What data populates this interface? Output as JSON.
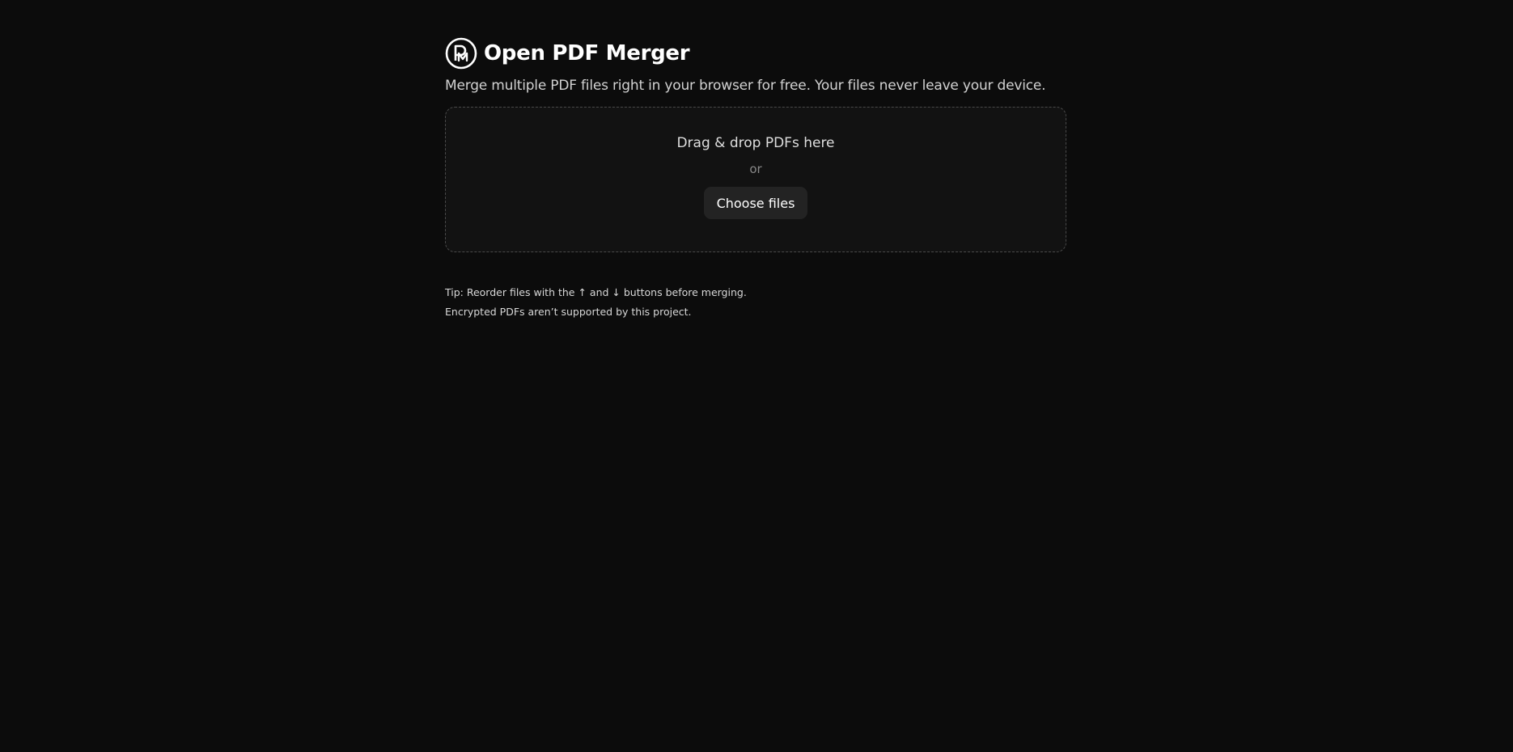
{
  "app": {
    "title": "Open PDF Merger",
    "subtitle": "Merge multiple PDF files right in your browser for free. Your files never leave your device.",
    "logo_icon": "pm-monogram-icon"
  },
  "dropzone": {
    "prompt": "Drag & drop PDFs here",
    "separator": "or",
    "choose_button_label": "Choose files"
  },
  "tips": [
    "Tip: Reorder files with the ↑ and ↓ buttons before merging.",
    "Encrypted PDFs aren’t supported by this project."
  ],
  "colors": {
    "background": "#0c0c0c",
    "dropzone_background": "#121212",
    "dropzone_border": "#4a4a4a",
    "button_background": "#232323",
    "text_primary": "#ffffff",
    "text_muted": "#888888"
  }
}
